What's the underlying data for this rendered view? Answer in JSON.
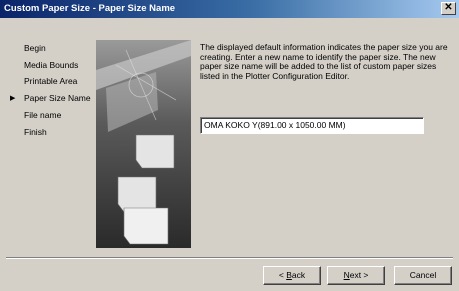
{
  "window": {
    "title": "Custom Paper Size - Paper Size Name",
    "close_glyph": "✕"
  },
  "steps": [
    {
      "label": "Begin",
      "active": false
    },
    {
      "label": "Media Bounds",
      "active": false
    },
    {
      "label": "Printable Area",
      "active": false
    },
    {
      "label": "Paper Size Name",
      "active": true
    },
    {
      "label": "File name",
      "active": false
    },
    {
      "label": "Finish",
      "active": false
    }
  ],
  "current_step_marker": "▶",
  "description": "The displayed default information indicates the paper size you are creating. Enter a new name to identify the paper size. The new paper size name will be added to the list of custom paper sizes listed in the Plotter Configuration Editor.",
  "paper_size_name": {
    "value": "OMA KOKO Y(891.00 x 1050.00 MM)"
  },
  "buttons": {
    "back": {
      "prefix": "< ",
      "hotkey": "B",
      "rest": "ack"
    },
    "next": {
      "prefix": "",
      "hotkey": "N",
      "rest": "ext >"
    },
    "cancel": "Cancel"
  },
  "icons": {
    "illustration": "plotter-and-paper-sheets-image"
  }
}
